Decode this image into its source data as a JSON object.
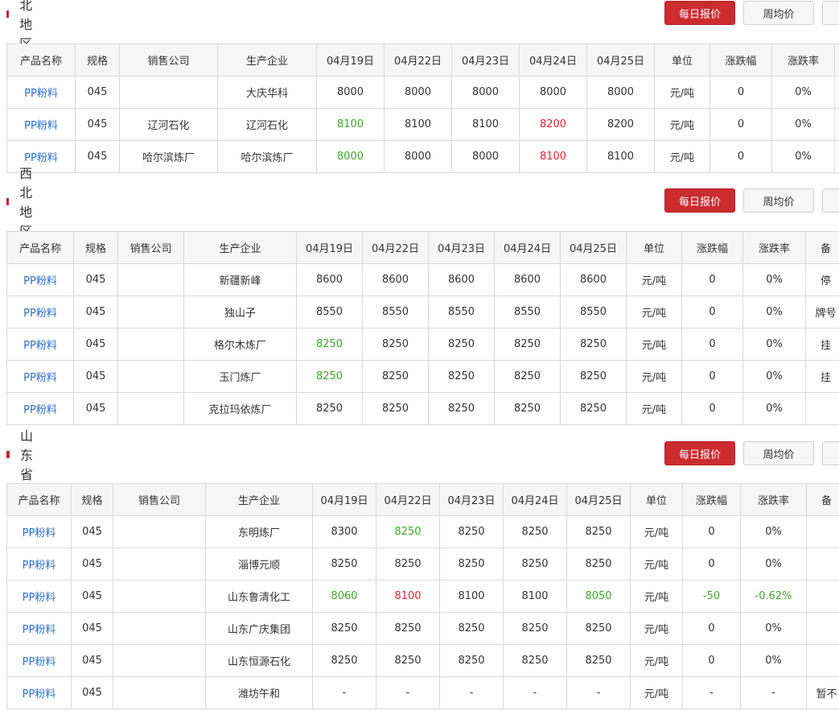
{
  "colors": {
    "accent": "#cc2b30",
    "link": "#2a6fcf",
    "down": "#3fa62b",
    "up": "#e0262c"
  },
  "buttons": {
    "daily": "每日报价",
    "weekly": "周均价"
  },
  "sections": [
    {
      "title": "东北地区",
      "headers": [
        "产品名称",
        "规格",
        "销售公司",
        "生产企业",
        "04月19日",
        "04月22日",
        "04月23日",
        "04月24日",
        "04月25日",
        "单位",
        "涨跌幅",
        "涨跌率",
        ""
      ],
      "rows": [
        [
          "PP粉料",
          "045",
          "",
          "大庆华科",
          "8000",
          "8000",
          "8000",
          "8000",
          "8000",
          "元/吨",
          "0",
          "0%",
          ""
        ],
        [
          "PP粉料",
          "045",
          "辽河石化",
          "辽河石化",
          "8100",
          "8100",
          "8100",
          "8200",
          "8200",
          "元/吨",
          "0",
          "0%",
          ""
        ],
        [
          "PP粉料",
          "045",
          "哈尔滨炼厂",
          "哈尔滨炼厂",
          "8000",
          "8000",
          "8000",
          "8100",
          "8100",
          "元/吨",
          "0",
          "0%",
          ""
        ]
      ],
      "styles": [
        [
          "",
          "",
          "",
          "",
          "",
          "",
          "",
          "",
          "",
          "",
          "",
          "",
          ""
        ],
        [
          "",
          "",
          "",
          "",
          "g",
          "",
          "",
          "r",
          "",
          "",
          "",
          "",
          ""
        ],
        [
          "",
          "",
          "",
          "",
          "g",
          "",
          "",
          "r",
          "",
          "",
          "",
          "",
          ""
        ]
      ]
    },
    {
      "title": "西北地区",
      "headers": [
        "产品名称",
        "规格",
        "销售公司",
        "生产企业",
        "04月19日",
        "04月22日",
        "04月23日",
        "04月24日",
        "04月25日",
        "单位",
        "涨跌幅",
        "涨跌率",
        "备"
      ],
      "rows": [
        [
          "PP粉料",
          "045",
          "",
          "新疆新峰",
          "8600",
          "8600",
          "8600",
          "8600",
          "8600",
          "元/吨",
          "0",
          "0%",
          "停"
        ],
        [
          "PP粉料",
          "045",
          "",
          "独山子",
          "8550",
          "8550",
          "8550",
          "8550",
          "8550",
          "元/吨",
          "0",
          "0%",
          "牌号"
        ],
        [
          "PP粉料",
          "045",
          "",
          "格尔木炼厂",
          "8250",
          "8250",
          "8250",
          "8250",
          "8250",
          "元/吨",
          "0",
          "0%",
          "挂"
        ],
        [
          "PP粉料",
          "045",
          "",
          "玉门炼厂",
          "8250",
          "8250",
          "8250",
          "8250",
          "8250",
          "元/吨",
          "0",
          "0%",
          "挂"
        ],
        [
          "PP粉料",
          "045",
          "",
          "克拉玛依炼厂",
          "8250",
          "8250",
          "8250",
          "8250",
          "8250",
          "元/吨",
          "0",
          "0%",
          ""
        ]
      ],
      "styles": [
        [
          "",
          "",
          "",
          "",
          "",
          "",
          "",
          "",
          "",
          "",
          "",
          "",
          ""
        ],
        [
          "",
          "",
          "",
          "",
          "",
          "",
          "",
          "",
          "",
          "",
          "",
          "",
          ""
        ],
        [
          "",
          "",
          "",
          "",
          "g",
          "",
          "",
          "",
          "",
          "",
          "",
          "",
          ""
        ],
        [
          "",
          "",
          "",
          "",
          "g",
          "",
          "",
          "",
          "",
          "",
          "",
          "",
          ""
        ],
        [
          "",
          "",
          "",
          "",
          "",
          "",
          "",
          "",
          "",
          "",
          "",
          "",
          ""
        ]
      ]
    },
    {
      "title": "山东省",
      "headers": [
        "产品名称",
        "规格",
        "销售公司",
        "生产企业",
        "04月19日",
        "04月22日",
        "04月23日",
        "04月24日",
        "04月25日",
        "单位",
        "涨跌幅",
        "涨跌率",
        "备"
      ],
      "rows": [
        [
          "PP粉料",
          "045",
          "",
          "东明炼厂",
          "8300",
          "8250",
          "8250",
          "8250",
          "8250",
          "元/吨",
          "0",
          "0%",
          ""
        ],
        [
          "PP粉料",
          "045",
          "",
          "淄博元顺",
          "8250",
          "8250",
          "8250",
          "8250",
          "8250",
          "元/吨",
          "0",
          "0%",
          ""
        ],
        [
          "PP粉料",
          "045",
          "",
          "山东鲁清化工",
          "8060",
          "8100",
          "8100",
          "8100",
          "8050",
          "元/吨",
          "-50",
          "-0.62%",
          ""
        ],
        [
          "PP粉料",
          "045",
          "",
          "山东广庆集团",
          "8250",
          "8250",
          "8250",
          "8250",
          "8250",
          "元/吨",
          "0",
          "0%",
          ""
        ],
        [
          "PP粉料",
          "045",
          "",
          "山东恒源石化",
          "8250",
          "8250",
          "8250",
          "8250",
          "8250",
          "元/吨",
          "0",
          "0%",
          ""
        ],
        [
          "PP粉料",
          "045",
          "",
          "潍坊午和",
          "-",
          "-",
          "-",
          "-",
          "-",
          "元/吨",
          "-",
          "-",
          "暂不"
        ]
      ],
      "styles": [
        [
          "",
          "",
          "",
          "",
          "",
          "g",
          "",
          "",
          "",
          "",
          "",
          "",
          ""
        ],
        [
          "",
          "",
          "",
          "",
          "",
          "",
          "",
          "",
          "",
          "",
          "",
          "",
          ""
        ],
        [
          "",
          "",
          "",
          "",
          "g",
          "r",
          "",
          "",
          "g",
          "",
          "g",
          "g",
          ""
        ],
        [
          "",
          "",
          "",
          "",
          "",
          "",
          "",
          "",
          "",
          "",
          "",
          "",
          ""
        ],
        [
          "",
          "",
          "",
          "",
          "",
          "",
          "",
          "",
          "",
          "",
          "",
          "",
          ""
        ],
        [
          "",
          "",
          "",
          "",
          "",
          "",
          "",
          "",
          "",
          "",
          "",
          "",
          ""
        ]
      ]
    }
  ]
}
